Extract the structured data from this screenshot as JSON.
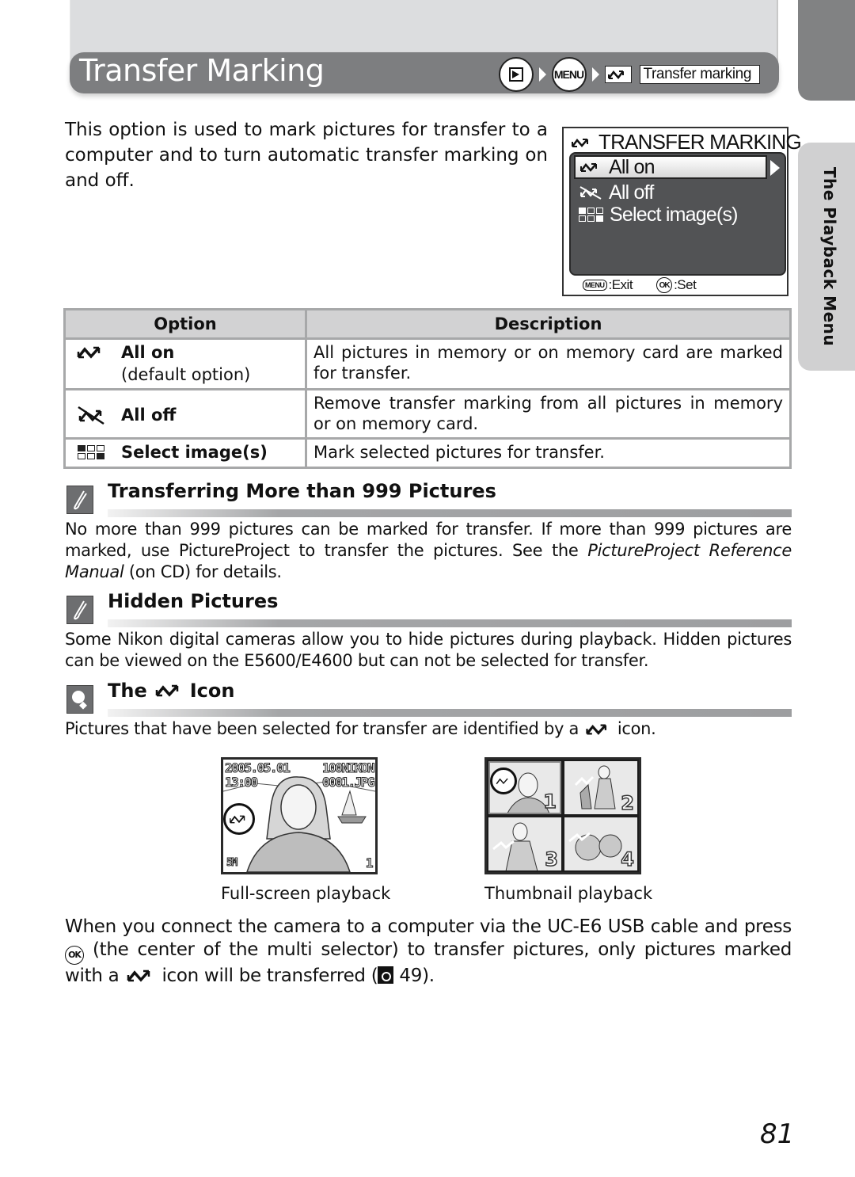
{
  "header": {
    "title": "Transfer Marking",
    "breadcrumb": {
      "step1_icon": "playback-button-icon",
      "step2_label": "MENU",
      "step3_icon": "transfer-mark-icon",
      "step3_label": "Transfer marking"
    }
  },
  "side_tab": {
    "label": "The Playback Menu"
  },
  "intro": "This option is used to mark pictures for transfer to a computer and to turn automatic transfer marking on and off.",
  "camera_screen": {
    "title": "TRANSFER MARKING",
    "items": [
      {
        "label": "All on",
        "icon": "transfer-mark-icon",
        "selected": true
      },
      {
        "label": "All off",
        "icon": "transfer-off-icon",
        "selected": false
      },
      {
        "label": "Select image(s)",
        "icon": "select-images-icon",
        "selected": false
      }
    ],
    "footer": {
      "exit_button": "MENU",
      "exit_label": ":Exit",
      "set_button": "OK",
      "set_label": ":Set"
    }
  },
  "options_table": {
    "headers": [
      "Option",
      "Description"
    ],
    "rows": [
      {
        "icon": "transfer-mark-icon",
        "option": "All on",
        "note": "(default option)",
        "description": "All pictures in memory or on memory card are marked for transfer."
      },
      {
        "icon": "transfer-off-icon",
        "option": "All off",
        "note": "",
        "description": "Remove transfer marking from all pictures in memory or on memory card."
      },
      {
        "icon": "select-images-icon",
        "option": "Select image(s)",
        "note": "",
        "description": "Mark selected pictures for transfer."
      }
    ]
  },
  "notes": [
    {
      "icon": "note-pencil-icon",
      "title": "Transferring More than 999 Pictures",
      "body_parts": [
        "No more than 999 pictures can be marked for transfer. If more than 999 pictures are marked, use PictureProject to transfer the pictures. See the ",
        "PictureProject Reference Manual",
        " (on CD) for details."
      ]
    },
    {
      "icon": "note-pencil-icon",
      "title": "Hidden Pictures",
      "body": "Some Nikon digital cameras allow you to hide pictures during playback. Hidden pictures can be viewed on the E5600/E4600 but can not be selected for transfer."
    },
    {
      "icon": "tip-bulb-icon",
      "title_before": "The",
      "title_icon": "transfer-mark-icon",
      "title_after": "Icon",
      "body_before": "Pictures that have been selected for transfer are identified by a",
      "body_after": "icon."
    }
  ],
  "figures": {
    "fullscreen": {
      "caption": "Full-screen playback",
      "date": "2005.05.01",
      "time": "13:00",
      "folder": "100NIKON",
      "file": "0001.JPG",
      "size": "5M",
      "frame_count": "1"
    },
    "thumbnail": {
      "caption": "Thumbnail playback",
      "thumbs": [
        "1",
        "2",
        "3",
        "4"
      ]
    }
  },
  "closing": {
    "part1": "When you connect the camera to a computer via the UC-E6 USB cable and press",
    "ok_label": "OK",
    "part2": "(the center of the multi selector) to transfer pictures, only pictures marked with a",
    "part3": "icon will be transferred (",
    "page_ref": " 49)."
  },
  "page_number": "81"
}
